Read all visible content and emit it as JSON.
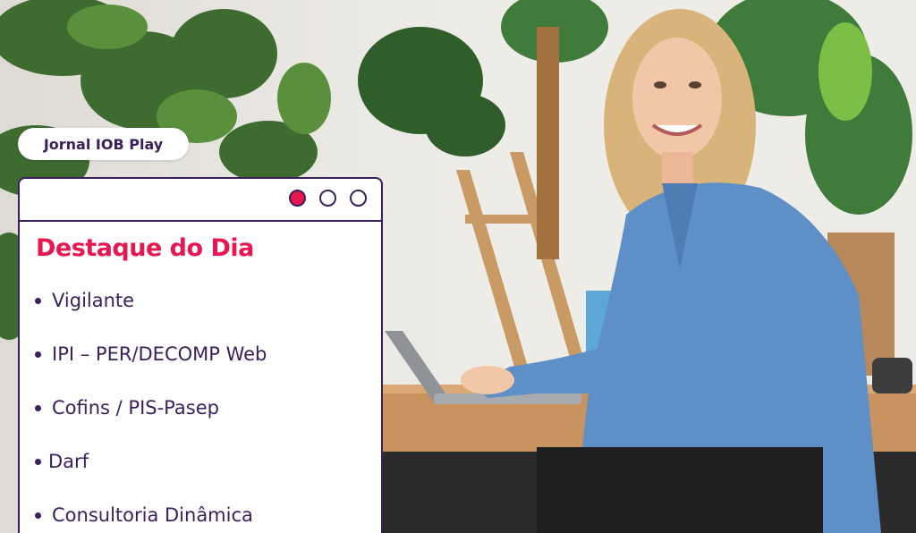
{
  "brand_badge": {
    "label": "Jornal IOB Play"
  },
  "window": {
    "controls": [
      "active-dot-icon",
      "circle-icon",
      "circle-icon"
    ],
    "title": "Destaque do Dia",
    "items": [
      {
        "label": "Vigilante"
      },
      {
        "label": "IPI – PER/DECOMP Web"
      },
      {
        "label": "Cofins / PIS-Pasep"
      },
      {
        "label": "Darf"
      },
      {
        "label": "Consultoria Dinâmica"
      }
    ]
  },
  "colors": {
    "accent": "#e8174f",
    "text_dark": "#3a1f5c",
    "card_bg": "#ffffff"
  }
}
